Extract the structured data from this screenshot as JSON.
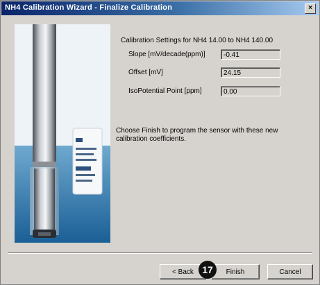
{
  "window": {
    "title": "NH4 Calibration Wizard - Finalize Calibration",
    "close_label": "×"
  },
  "settings": {
    "heading": "Calibration Settings for NH4 14.00  to NH4 140.00",
    "slope_label": "Slope  [mV/decade(ppm)]",
    "slope_value": "-0.41",
    "offset_label": "Offset  [mV]",
    "offset_value": "24.15",
    "isopotential_label": "IsoPotential Point [ppm]",
    "isopotential_value": "0.00"
  },
  "info": {
    "text": "Choose Finish to program the sensor with these new calibration coefficients."
  },
  "buttons": {
    "back": "< Back",
    "finish": "Finish",
    "cancel": "Cancel"
  },
  "callout": {
    "number": "17"
  },
  "colors": {
    "title_bar_start": "#0a246a",
    "title_bar_end": "#a6caf0",
    "dialog_face": "#d6d3ce",
    "callout_bg": "#111111"
  }
}
